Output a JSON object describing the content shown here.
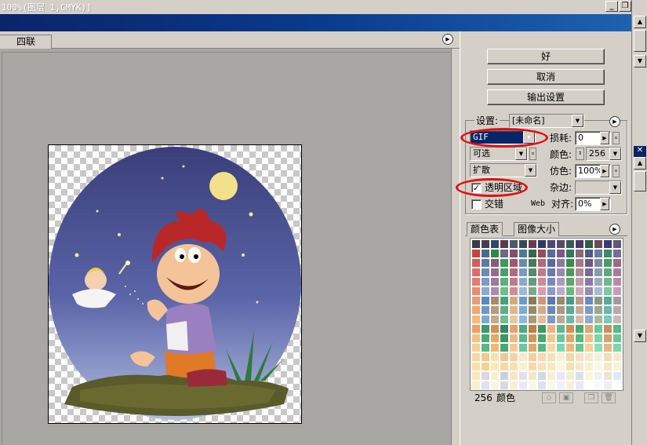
{
  "window": {
    "title": "100%(图层 1,CMYK)]"
  },
  "document_tab": {
    "label": "四联"
  },
  "actions": {
    "ok_label": "好",
    "cancel_label": "取消",
    "output_label": "输出设置"
  },
  "settings": {
    "preset_label": "设置:",
    "preset_value": "[未命名]",
    "format_value": "GIF",
    "loss_label": "损耗:",
    "loss_value": "0",
    "reduction_value": "可选",
    "colors_label": "颜色:",
    "colors_value": "256",
    "dither_algo_value": "扩散",
    "dither_label": "仿色:",
    "dither_value": "100%",
    "transparency_label": "透明区域",
    "transparency_checked": true,
    "matte_label": "杂边:",
    "matte_value": "",
    "interlaced_label": "交错",
    "interlaced_checked": false,
    "web_label": "Web",
    "websnap_label": "对齐:",
    "websnap_value": "0%"
  },
  "palette_tabs": {
    "color_table": "颜色表",
    "image_size": "图像大小"
  },
  "color_table": {
    "count": "256",
    "unit": "颜色",
    "colors": [
      "#3a3a4a",
      "#4a3a52",
      "#2e4a6a",
      "#5a3a4a",
      "#4a5a6a",
      "#3a4a5a",
      "#6a3a52",
      "#2e3a62",
      "#4a4a7a",
      "#5a4a6a",
      "#3a5a52",
      "#4a3a6a",
      "#2e5a4a",
      "#6a4a5a",
      "#3a3a7a",
      "#5a5a7a",
      "#c8443a",
      "#4a6a8a",
      "#2e8a4a",
      "#6a6a8a",
      "#8a4a6a",
      "#4a7a9a",
      "#3a6a4a",
      "#9a4a5a",
      "#5a6a9a",
      "#7a5a8a",
      "#2e7a5a",
      "#8a6a7a",
      "#4a5a8a",
      "#6a7a9a",
      "#3a8a6a",
      "#7a6a9a",
      "#d85a5a",
      "#5a7aa0",
      "#8a5a7a",
      "#3a9a5a",
      "#a05a6a",
      "#6a8ab0",
      "#4a7a5a",
      "#b06a7a",
      "#5a6aa0",
      "#8a7aa0",
      "#3a8a4a",
      "#a07a8a",
      "#6a5a8a",
      "#7a8aa0",
      "#4a9a6a",
      "#9a6a8a",
      "#e06a6a",
      "#6a8ab8",
      "#9a6a8a",
      "#4aa06a",
      "#b06a7a",
      "#7a9ac0",
      "#5a8a6a",
      "#c07a8a",
      "#6a7ab0",
      "#9a8ab0",
      "#4a9a5a",
      "#b08a9a",
      "#7a6a9a",
      "#8a9ab0",
      "#5aaa7a",
      "#aa7a9a",
      "#e87a6a",
      "#7a9ac8",
      "#a07a9a",
      "#5ab07a",
      "#c07a8a",
      "#8aaad0",
      "#6a9a7a",
      "#d08a9a",
      "#7a8ac0",
      "#aa9ac0",
      "#5aaa6a",
      "#c09aaa",
      "#8a7aaa",
      "#9aaac0",
      "#6aba8a",
      "#ba8aaa",
      "#f08a6a",
      "#8aaad0",
      "#b08aaa",
      "#6ac08a",
      "#d08a9a",
      "#9abad8",
      "#7aaa8a",
      "#e09aaa",
      "#8a9ad0",
      "#baaad0",
      "#6aba7a",
      "#d0aaba",
      "#9a8aba",
      "#aabad0",
      "#7aca9a",
      "#ca9aba",
      "#e89a7a",
      "#5a8ac0",
      "#aa8a6a",
      "#4aa07a",
      "#d8aa7a",
      "#6a9ad0",
      "#8a7a5a",
      "#c89a7a",
      "#5a7ab0",
      "#9a8a70",
      "#4a9a8a",
      "#b89a8a",
      "#6a8ac0",
      "#8a9a80",
      "#5aaa9a",
      "#a89a9a",
      "#f0aa6a",
      "#6a9ac8",
      "#ba9a7a",
      "#5ab08a",
      "#e0b88a",
      "#7aaad8",
      "#9a8a6a",
      "#d8aa8a",
      "#6a8ab8",
      "#aa9a80",
      "#5aaa9a",
      "#c8aa9a",
      "#7a9ac8",
      "#9aaa90",
      "#6abaaa",
      "#b8aaaa",
      "#f8b87a",
      "#7aaad0",
      "#c8aa8a",
      "#6ac09a",
      "#e8c89a",
      "#8abae0",
      "#aa9a7a",
      "#e8ba9a",
      "#7a9ac0",
      "#baaa90",
      "#6abaaa",
      "#d8baaa",
      "#8aaad0",
      "#aabaa0",
      "#7acaba",
      "#c8baba",
      "#f0a060",
      "#3a9a70",
      "#d89050",
      "#2e8a60",
      "#e8a070",
      "#4aaa80",
      "#c08040",
      "#3a9a60",
      "#f8b080",
      "#5aba90",
      "#d09050",
      "#4aaa70",
      "#e0a870",
      "#6aca98",
      "#c89060",
      "#58b888",
      "#f8c080",
      "#48a878",
      "#e8a860",
      "#389868",
      "#f0b888",
      "#58b890",
      "#d09858",
      "#48a870",
      "#f8c890",
      "#68c8a0",
      "#e0a868",
      "#58b880",
      "#f0c088",
      "#78d8a8",
      "#d8a070",
      "#68c898",
      "#f8d090",
      "#58b888",
      "#f0b870",
      "#48a878",
      "#f8c898",
      "#68c8a0",
      "#e0a868",
      "#58b880",
      "#f8d8a0",
      "#78d8b0",
      "#f0b878",
      "#68c890",
      "#f8d098",
      "#88e0b8",
      "#e8b880",
      "#78d8a8",
      "#f8d8a0",
      "#f8c888",
      "#f8e0b0",
      "#f0c890",
      "#f8d0a8",
      "#f8e8c0",
      "#f0d0a0",
      "#f8d8b0",
      "#f8e0b8",
      "#f8f0d0",
      "#f0d8a8",
      "#f8e0c0",
      "#f8e8c8",
      "#f8f0d8",
      "#f0e0b8",
      "#f8e8d0",
      "#f8e0a8",
      "#f8d090",
      "#f8e8b8",
      "#f8d8a0",
      "#f8e0b0",
      "#f8f0c8",
      "#f8d8a8",
      "#f8e0b8",
      "#f8e8c0",
      "#f8f8e0",
      "#f8e0b0",
      "#f8e8c8",
      "#f8f0d0",
      "#f8f8e8",
      "#f8e8c0",
      "#f8f0d8",
      "#f8e8b8",
      "#d8d8e8",
      "#f8f0c8",
      "#c8d0e0",
      "#f8e8c0",
      "#e0e0f0",
      "#f0e8c8",
      "#d0d8e8",
      "#f8f0d0",
      "#e8e8f8",
      "#f0f0d0",
      "#d8e0f0",
      "#f8f8d8",
      "#f0f0f8",
      "#e8e8d0",
      "#e0e8f8",
      "#f8f0c8",
      "#e0e0f0",
      "#f8f8d8",
      "#d8d8e8",
      "#f8f0d0",
      "#e8e8f8",
      "#f8f8e0",
      "#e0e0f0",
      "#f8f8e8",
      "#f0f0ff",
      "#f8f0d8",
      "#e8e8f8",
      "#ffffff",
      "#f8f8ff",
      "#eeeeee",
      "#ffffff"
    ]
  }
}
